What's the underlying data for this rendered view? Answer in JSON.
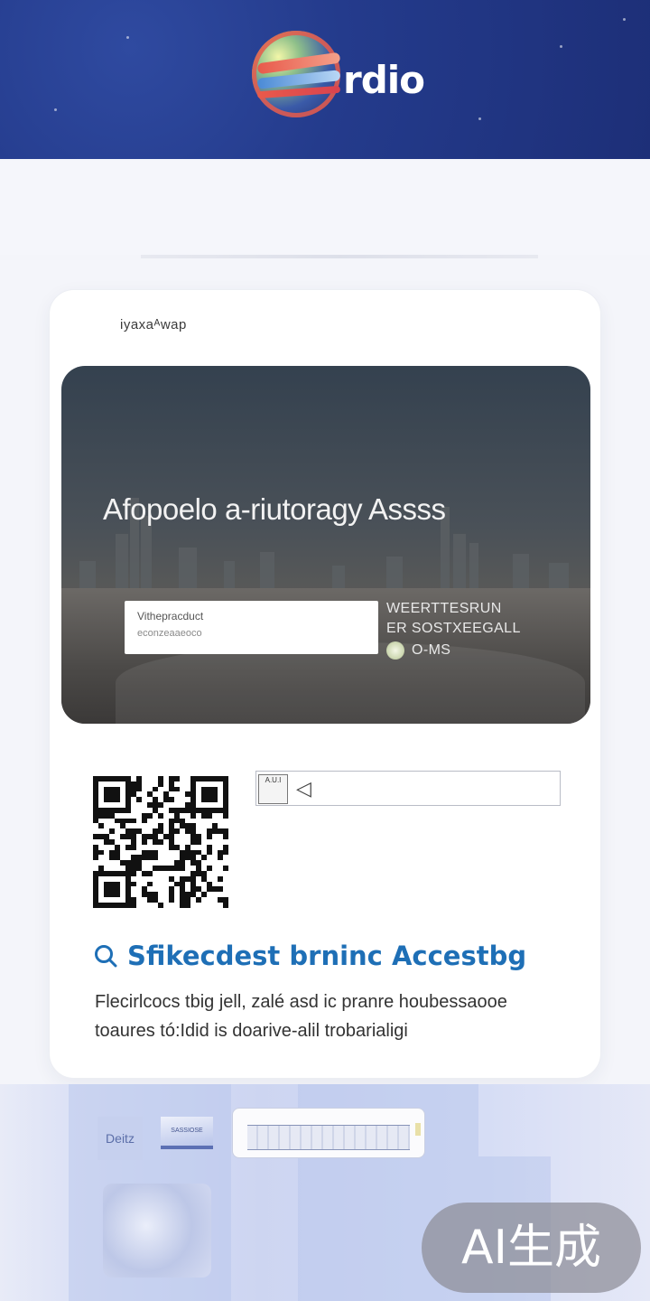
{
  "header": {
    "brand": "rdio",
    "colors": {
      "background": "#243b8c",
      "swoosh_red": "#e85a4b",
      "swoosh_blue": "#4a8ad6"
    }
  },
  "card": {
    "label": "iyaxaᴬwap",
    "hero": {
      "title": "Afopoelo a-riutoragy Assss",
      "input_label": "Vithepracduct",
      "input_value": "econzeaaeoco",
      "side_line1": "WEERTTESRUN",
      "side_line2": "ER SOSTXEEGALL",
      "side_line3": "O-MS"
    },
    "mini_panel": {
      "thumb_text": "A.U.I",
      "arrow": "◁"
    },
    "feature": {
      "title": "Sfikecdest brninc Accestbg",
      "icon": "search-icon",
      "desc_line1": "Flecirlcocs tbig  jell, zalé asd  ic pranre houbessaooe",
      "desc_line2": "toaures tó:Idid is doarive-alil trobarialigi",
      "accent": "#1e6fb6"
    }
  },
  "footer": {
    "item1_text": "Deitz",
    "item2_text": "SASSIOSE"
  },
  "badge": {
    "text": "AI生成"
  }
}
